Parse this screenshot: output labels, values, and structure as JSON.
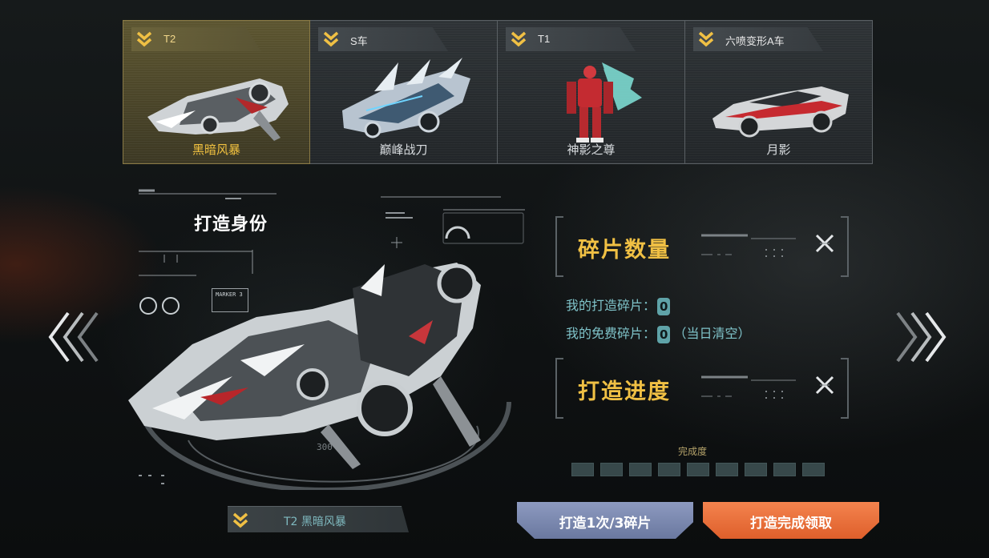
{
  "tabs": [
    {
      "tag": "T2",
      "name": "黑暗风暴",
      "active": true
    },
    {
      "tag": "S车",
      "name": "巅峰战刀",
      "active": false
    },
    {
      "tag": "T1",
      "name": "神影之尊",
      "active": false
    },
    {
      "tag": "六喷变形A车",
      "name": "月影",
      "active": false
    }
  ],
  "hud": {
    "title": "打造身份",
    "marker": "MARKER 3",
    "dial_number": "300"
  },
  "fragments": {
    "title": "碎片数量",
    "mine_label": "我的打造碎片：",
    "mine_value": "0",
    "free_label": "我的免费碎片：",
    "free_value": "0",
    "free_note": "（当日清空）"
  },
  "progress": {
    "title": "打造进度",
    "complete_label": "完成度",
    "segments_total": 9,
    "segments_filled": 0
  },
  "current": {
    "label": "T2 黑暗风暴"
  },
  "buttons": {
    "forge": "打造1次/3碎片",
    "claim": "打造完成领取"
  },
  "colors": {
    "accent_gold": "#f0c044",
    "accent_teal": "#7fc3c9",
    "forge_button": "#7b88b0",
    "claim_button": "#ee7340"
  },
  "icons": [
    "chevron-double-down-icon",
    "close-x-icon",
    "arrow-left-icon",
    "arrow-right-icon"
  ]
}
